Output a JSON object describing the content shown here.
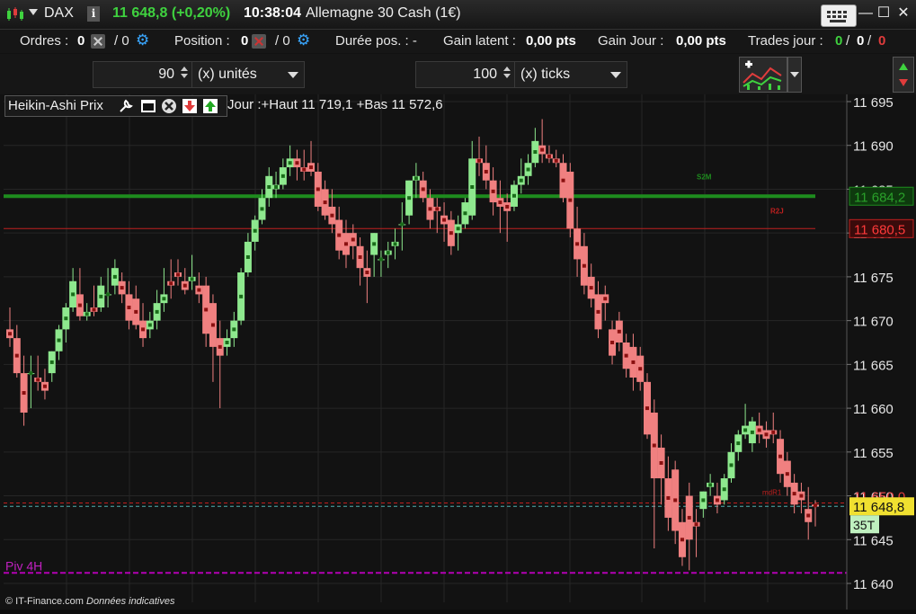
{
  "titlebar": {
    "symbol": "DAX",
    "info_label": "i",
    "last_price": "11 648,8 (+0,20%)",
    "time": "10:38:04",
    "instrument": "Allemagne 30 Cash (1€)",
    "minimize": "—",
    "maximize": "☐",
    "close": "✕"
  },
  "status": {
    "orders_label": "Ordres :",
    "orders_a": "0",
    "orders_b": "/ 0",
    "position_label": "Position :",
    "position_a": "0",
    "position_b": "/ 0",
    "duration_label": "Durée pos. : -",
    "gain_latent_label": "Gain latent :",
    "gain_latent_value": "0,00 pts",
    "gain_jour_label": "Gain Jour :",
    "gain_jour_value": "0,00 pts",
    "trades_label": "Trades jour :",
    "trades_win": "0",
    "trades_sep1": "/",
    "trades_flat": "0",
    "trades_sep2": "/",
    "trades_loss": "0"
  },
  "controls": {
    "qty_value": "90",
    "qty_unit": "(x) unités",
    "ticks_value": "100",
    "ticks_unit": "(x) ticks"
  },
  "legend": {
    "title": "Heikin-Ashi Prix",
    "range": "Jour :+Haut 11 719,1 +Bas 11 572,6"
  },
  "footer": {
    "copyright": "© IT-Finance.com",
    "disclaimer": "Données indicatives"
  },
  "colors": {
    "bull": "#8ee88e",
    "bear": "#f08080",
    "s2m_line": "#1e8c1e",
    "r2j_line": "#c0201f",
    "piv4h_line": "#b300b3",
    "price_line": "#4fb0b0"
  },
  "chart_data": {
    "type": "candlestick",
    "title": "",
    "xlabel": "",
    "ylabel": "",
    "ylim": [
      11640,
      11695
    ],
    "y_ticks": [
      "11 695",
      "11 690",
      "11 685",
      "11 680",
      "11 675",
      "11 670",
      "11 665",
      "11 660",
      "11 655",
      "11 650",
      "11 645",
      "11 640"
    ],
    "grid": true,
    "levels": [
      {
        "name": "S2M",
        "value": 11684.2,
        "label": "11 684,2",
        "color": "#1e8c1e",
        "style": "solid"
      },
      {
        "name": "R2J",
        "value": 11680.5,
        "label": "11 680,5",
        "color": "#c0201f",
        "style": "solid"
      },
      {
        "name": "mdR1",
        "value": 11650.0,
        "label": "11 650,0",
        "color": "#c0201f",
        "style": "dashed"
      },
      {
        "name": "Piv 4H",
        "value": 11641.2,
        "label": "Piv 4H",
        "color": "#b300b3",
        "style": "dashed"
      }
    ],
    "last_price": {
      "value": 11648.8,
      "label": "11 648,8",
      "countdown": "35T"
    },
    "series": [
      {
        "name": "Heikin-Ashi Prix",
        "ohlc": [
          [
            11669.0,
            11671.5,
            11667.0,
            11668.0
          ],
          [
            11668.0,
            11669.5,
            11663.5,
            11664.0
          ],
          [
            11664.0,
            11666.0,
            11658.0,
            11659.5
          ],
          [
            11664.0,
            11666.0,
            11660.0,
            11664.0
          ],
          [
            11663.5,
            11666.0,
            11662.0,
            11663.0
          ],
          [
            11663.0,
            11664.5,
            11661.0,
            11662.0
          ],
          [
            11664.0,
            11666.5,
            11663.0,
            11666.5
          ],
          [
            11666.5,
            11669.5,
            11665.5,
            11669.0
          ],
          [
            11669.0,
            11672.0,
            11667.5,
            11671.5
          ],
          [
            11671.5,
            11676.0,
            11671.0,
            11674.5
          ],
          [
            11673.0,
            11676.0,
            11670.0,
            11670.5
          ],
          [
            11670.5,
            11672.0,
            11670.0,
            11671.0
          ],
          [
            11671.5,
            11674.0,
            11670.5,
            11671.0
          ],
          [
            11671.5,
            11675.0,
            11671.0,
            11674.0
          ],
          [
            11673.0,
            11676.0,
            11671.5,
            11673.0
          ],
          [
            11674.0,
            11677.0,
            11673.0,
            11676.0
          ],
          [
            11674.5,
            11675.5,
            11672.0,
            11673.0
          ],
          [
            11673.0,
            11674.5,
            11669.0,
            11670.0
          ],
          [
            11672.5,
            11674.0,
            11669.0,
            11669.5
          ],
          [
            11670.0,
            11672.0,
            11667.0,
            11668.0
          ],
          [
            11669.0,
            11671.0,
            11668.0,
            11670.0
          ],
          [
            11670.0,
            11673.5,
            11669.0,
            11672.0
          ],
          [
            11672.0,
            11676.0,
            11671.0,
            11673.0
          ],
          [
            11674.5,
            11677.0,
            11672.5,
            11674.0
          ],
          [
            11675.5,
            11677.0,
            11674.0,
            11675.0
          ],
          [
            11674.5,
            11676.0,
            11673.0,
            11673.5
          ],
          [
            11674.5,
            11677.5,
            11673.5,
            11675.0
          ],
          [
            11674.0,
            11675.5,
            11672.0,
            11673.0
          ],
          [
            11674.0,
            11675.0,
            11667.0,
            11668.5
          ],
          [
            11672.0,
            11673.0,
            11663.0,
            11667.0
          ],
          [
            11668.0,
            11670.0,
            11660.0,
            11666.0
          ],
          [
            11667.0,
            11669.0,
            11666.0,
            11668.0
          ],
          [
            11668.0,
            11671.0,
            11667.0,
            11670.0
          ],
          [
            11670.0,
            11676.0,
            11669.5,
            11675.5
          ],
          [
            11675.5,
            11680.0,
            11675.0,
            11679.0
          ],
          [
            11679.0,
            11682.0,
            11678.0,
            11681.5
          ],
          [
            11681.5,
            11685.0,
            11681.0,
            11684.0
          ],
          [
            11684.0,
            11687.5,
            11683.0,
            11686.5
          ],
          [
            11685.0,
            11687.0,
            11684.0,
            11685.5
          ],
          [
            11685.5,
            11688.5,
            11685.0,
            11687.5
          ],
          [
            11687.5,
            11690.0,
            11686.5,
            11688.5
          ],
          [
            11688.5,
            11689.5,
            11686.0,
            11687.5
          ],
          [
            11687.5,
            11689.5,
            11686.0,
            11687.0
          ],
          [
            11688.0,
            11690.5,
            11686.5,
            11687.0
          ],
          [
            11687.0,
            11688.0,
            11682.5,
            11683.0
          ],
          [
            11685.0,
            11686.0,
            11681.5,
            11682.0
          ],
          [
            11683.0,
            11685.0,
            11680.0,
            11681.0
          ],
          [
            11681.5,
            11683.0,
            11677.0,
            11678.0
          ],
          [
            11680.0,
            11681.5,
            11676.0,
            11677.5
          ],
          [
            11680.0,
            11681.0,
            11677.0,
            11678.5
          ],
          [
            11678.5,
            11679.5,
            11674.0,
            11676.0
          ],
          [
            11676.0,
            11678.0,
            11672.0,
            11675.0
          ],
          [
            11677.5,
            11680.0,
            11675.0,
            11680.0
          ],
          [
            11677.0,
            11678.0,
            11675.0,
            11677.0
          ],
          [
            11677.5,
            11679.0,
            11676.0,
            11678.0
          ],
          [
            11678.5,
            11680.5,
            11677.0,
            11679.0
          ],
          [
            11681.0,
            11683.5,
            11678.0,
            11681.0
          ],
          [
            11682.0,
            11686.0,
            11681.0,
            11686.0
          ],
          [
            11686.0,
            11688.0,
            11684.0,
            11686.5
          ],
          [
            11686.0,
            11687.0,
            11683.5,
            11684.0
          ],
          [
            11684.0,
            11685.0,
            11680.5,
            11681.5
          ],
          [
            11683.0,
            11684.0,
            11680.0,
            11682.5
          ],
          [
            11682.0,
            11683.5,
            11679.0,
            11681.0
          ],
          [
            11681.5,
            11682.5,
            11677.5,
            11678.5
          ],
          [
            11680.0,
            11682.0,
            11678.0,
            11681.0
          ],
          [
            11681.0,
            11684.0,
            11680.5,
            11683.5
          ],
          [
            11682.0,
            11690.5,
            11681.5,
            11688.5
          ],
          [
            11688.5,
            11691.0,
            11686.5,
            11688.0
          ],
          [
            11688.0,
            11690.0,
            11685.0,
            11686.0
          ],
          [
            11686.0,
            11687.5,
            11682.0,
            11683.5
          ],
          [
            11684.0,
            11686.0,
            11680.0,
            11683.0
          ],
          [
            11683.5,
            11684.5,
            11679.0,
            11682.5
          ],
          [
            11683.0,
            11686.0,
            11682.5,
            11685.5
          ],
          [
            11685.5,
            11688.5,
            11684.5,
            11686.5
          ],
          [
            11686.5,
            11689.0,
            11685.5,
            11688.0
          ],
          [
            11688.0,
            11692.0,
            11687.5,
            11690.5
          ],
          [
            11690.0,
            11693.0,
            11688.0,
            11689.0
          ],
          [
            11689.0,
            11690.0,
            11688.0,
            11688.5
          ],
          [
            11688.5,
            11689.5,
            11687.5,
            11688.0
          ],
          [
            11688.0,
            11689.0,
            11683.5,
            11684.0
          ],
          [
            11687.0,
            11688.0,
            11679.5,
            11680.5
          ],
          [
            11680.5,
            11683.0,
            11675.0,
            11677.0
          ],
          [
            11678.5,
            11680.0,
            11673.0,
            11674.0
          ],
          [
            11675.0,
            11676.5,
            11671.5,
            11672.5
          ],
          [
            11673.0,
            11674.5,
            11668.0,
            11669.0
          ],
          [
            11673.0,
            11674.0,
            11670.0,
            11672.0
          ],
          [
            11669.0,
            11670.0,
            11665.0,
            11666.0
          ],
          [
            11670.0,
            11671.0,
            11666.5,
            11667.5
          ],
          [
            11667.5,
            11668.5,
            11663.5,
            11664.5
          ],
          [
            11667.0,
            11668.5,
            11662.0,
            11663.5
          ],
          [
            11666.0,
            11667.0,
            11662.0,
            11663.0
          ],
          [
            11663.0,
            11664.0,
            11656.5,
            11657.0
          ],
          [
            11659.5,
            11661.0,
            11644.0,
            11652.0
          ],
          [
            11655.5,
            11657.0,
            11649.0,
            11652.0
          ],
          [
            11652.0,
            11654.5,
            11646.0,
            11647.5
          ],
          [
            11653.0,
            11654.0,
            11644.5,
            11646.0
          ],
          [
            11647.0,
            11648.5,
            11642.0,
            11643.0
          ],
          [
            11650.0,
            11651.5,
            11641.5,
            11645.0
          ],
          [
            11647.0,
            11648.5,
            11643.0,
            11646.5
          ],
          [
            11648.5,
            11650.5,
            11647.5,
            11650.5
          ],
          [
            11651.0,
            11652.5,
            11650.0,
            11651.5
          ],
          [
            11650.0,
            11651.5,
            11648.0,
            11649.0
          ],
          [
            11649.5,
            11652.5,
            11649.0,
            11652.0
          ],
          [
            11652.0,
            11656.0,
            11651.5,
            11655.0
          ],
          [
            11655.0,
            11657.5,
            11654.0,
            11657.0
          ],
          [
            11657.0,
            11660.5,
            11656.5,
            11658.0
          ],
          [
            11656.0,
            11659.0,
            11655.0,
            11658.5
          ],
          [
            11658.0,
            11659.5,
            11656.0,
            11657.0
          ],
          [
            11657.5,
            11658.5,
            11655.5,
            11656.5
          ],
          [
            11657.5,
            11659.5,
            11656.0,
            11657.0
          ],
          [
            11656.5,
            11657.5,
            11651.5,
            11652.5
          ],
          [
            11654.0,
            11655.0,
            11650.0,
            11651.0
          ],
          [
            11651.5,
            11652.5,
            11648.0,
            11649.0
          ],
          [
            11650.5,
            11651.5,
            11648.0,
            11649.5
          ],
          [
            11648.5,
            11651.0,
            11645.0,
            11647.0
          ],
          [
            11649.0,
            11649.5,
            11646.5,
            11648.8
          ]
        ]
      }
    ]
  }
}
